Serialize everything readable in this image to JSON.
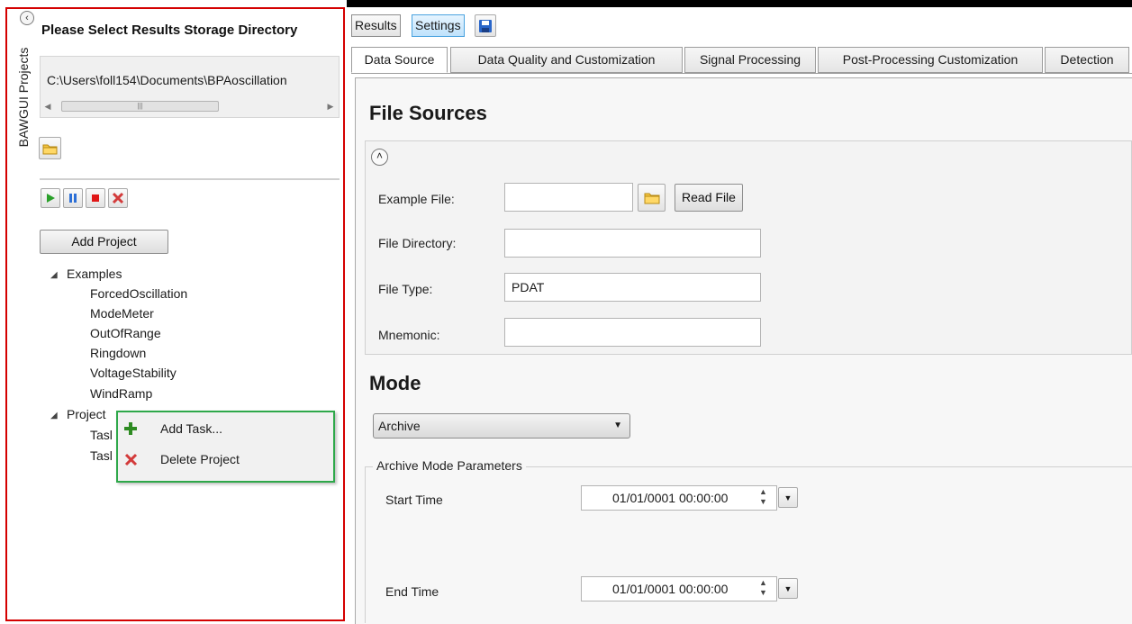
{
  "left_panel": {
    "vertical_tab_label": "BAWGUI Projects",
    "heading": "Please Select Results Storage Directory",
    "directory_path": "C:\\Users\\foll154\\Documents\\BPAoscillation",
    "control_buttons": [
      "run",
      "pause",
      "stop",
      "delete"
    ],
    "add_project_label": "Add Project",
    "tree": {
      "examples_label": "Examples",
      "examples": [
        "ForcedOscillation",
        "ModeMeter",
        "OutOfRange",
        "Ringdown",
        "VoltageStability",
        "WindRamp"
      ],
      "project_label": "Project",
      "project_children": [
        "Tasl",
        "Tasl"
      ]
    },
    "context_menu": {
      "items": [
        {
          "label": "Add Task...",
          "icon": "plus-icon",
          "color": "#2e8b22"
        },
        {
          "label": "Delete Project",
          "icon": "x-icon",
          "color": "#d33b3b"
        }
      ]
    },
    "border_color": "#d40000",
    "menu_border_color": "#2ea84a"
  },
  "toolbar": {
    "results_label": "Results",
    "settings_label": "Settings",
    "save_icon": "save-icon"
  },
  "tabs": [
    {
      "label": "Data Source",
      "active": true
    },
    {
      "label": "Data Quality and Customization",
      "active": false
    },
    {
      "label": "Signal Processing",
      "active": false
    },
    {
      "label": "Post-Processing Customization",
      "active": false
    },
    {
      "label": "Detection",
      "active": false
    }
  ],
  "file_sources": {
    "title": "File Sources",
    "example_file_label": "Example File:",
    "example_file_value": "",
    "read_file_label": "Read File",
    "file_directory_label": "File Directory:",
    "file_directory_value": "",
    "file_type_label": "File Type:",
    "file_type_value": "PDAT",
    "mnemonic_label": "Mnemonic:",
    "mnemonic_value": ""
  },
  "mode": {
    "title": "Mode",
    "selected": "Archive",
    "archive_params_title": "Archive Mode Parameters",
    "start_time_label": "Start Time",
    "start_time_value": "01/01/0001 00:00:00",
    "end_time_label": "End Time",
    "end_time_value": "01/01/0001 00:00:00"
  }
}
